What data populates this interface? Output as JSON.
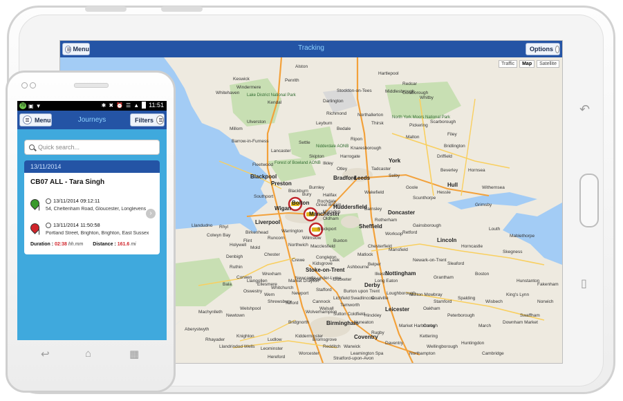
{
  "tablet": {
    "menu_label": "Menu",
    "title": "Tracking",
    "options_label": "Options",
    "map_types": [
      "Traffic",
      "Map",
      "Satellite"
    ],
    "map_type_selected": "Map",
    "map_labels": [
      "Windermere",
      "Kendal",
      "Lake District National Park",
      "Whitehaven",
      "Ulverston",
      "Millom",
      "Barrow-in-Furness",
      "Lancaster",
      "Fleetwood",
      "Blackpool",
      "Forest of Bowland AONB",
      "Preston",
      "Southport",
      "Blackburn",
      "Burnley",
      "Wigan",
      "Bolton",
      "Manchester",
      "Stockport",
      "Liverpool",
      "Birkenhead",
      "Warrington",
      "Runcorn",
      "Chester",
      "Colwyn Bay",
      "Wrexham",
      "Macclesfield",
      "Congleton",
      "Stoke-on-Trent",
      "Newcastle-under-Lyme",
      "Stafford",
      "Telford",
      "Shrewsbury",
      "Nidderdale AONB",
      "Harrogate",
      "Leeds",
      "Bradford",
      "Huddersfield",
      "Halifax",
      "Wakefield",
      "Barnsley",
      "Sheffield",
      "Doncaster",
      "Scunthorpe",
      "Grimsby",
      "York",
      "Selby",
      "Hull",
      "Bridlington",
      "Scarborough",
      "Whitby",
      "Middlesbrough",
      "Stockton-on-Tees",
      "Darlington",
      "North York Moors National Park",
      "Ripon",
      "Thirsk",
      "Malton",
      "Pickering",
      "Lincoln",
      "Worksop",
      "Chesterfield",
      "Mansfield",
      "Nottingham",
      "Derby",
      "Loughborough",
      "Leicester",
      "Newark-on-Trent",
      "Grantham",
      "Boston",
      "Skegness",
      "Louth",
      "Peterborough",
      "King's Lynn",
      "Norwich",
      "Cambridge",
      "Northampton",
      "Coventry",
      "Birmingham",
      "Wolverhampton",
      "Walsall",
      "Tamworth",
      "Nuneaton",
      "Rugby",
      "Leamington Spa",
      "Kidderminster",
      "Bromsgrove",
      "Redditch",
      "Aberystwyth",
      "Wisbech",
      "Spalding",
      "Stamford",
      "Kettering",
      "Corby",
      "Burton upon Trent",
      "Lichfield",
      "Cannock",
      "Sutton Coldfield",
      "Buxton",
      "Matlock",
      "Hornsea",
      "Goole",
      "Penrith",
      "Great Britain",
      "Marsden",
      "Gainsborough",
      "Retford",
      "Whitchurch",
      "Newtown",
      "Welshpool",
      "Bridgnorth",
      "Kidsgrove",
      "Leek",
      "Crewe",
      "Northwich",
      "Wilmslow",
      "Bury",
      "Rochdale",
      "Oldham",
      "Keswick",
      "Alston",
      "Richmond",
      "Leyburn",
      "Settle",
      "Skipton",
      "Ilkley",
      "Otley",
      "Knaresborough",
      "Tadcaster",
      "Rotherham",
      "Hessle",
      "Withernsea",
      "Beverley",
      "Driffield",
      "Filey",
      "Hartlepool",
      "Redcar",
      "Guisborough",
      "Northallerton",
      "Bedale",
      "Mold",
      "Flint",
      "Holywell",
      "Rhyl",
      "Denbigh",
      "Ruthin",
      "Llandudno",
      "Oswestry",
      "Ellesmere",
      "Market Drayton",
      "Stone",
      "Uttoxeter",
      "Ashbourne",
      "Belper",
      "Ilkeston",
      "Long Eaton",
      "Melton Mowbray",
      "Oakham",
      "Sleaford",
      "Horncastle",
      "Mablethorpe",
      "Hunstanton",
      "Fakenham",
      "Swaffham",
      "Downham Market",
      "March",
      "Huntingdon",
      "Wellingborough",
      "Market Harborough",
      "Hinckley",
      "Coalville",
      "Swadlincote",
      "Daventry",
      "Warwick",
      "Stratford-upon-Avon",
      "Worcester",
      "Hereford",
      "Ludlow",
      "Leominster",
      "Knighton",
      "Llandrindod Wells",
      "Rhayader",
      "Machynlleth",
      "Bala",
      "Corwen",
      "Llangollen",
      "Wem",
      "Newport"
    ],
    "vehicle_markers": [
      "marker-1",
      "marker-2",
      "marker-3"
    ]
  },
  "phone": {
    "status_bar": {
      "badge": "70",
      "time": "11:51"
    },
    "menu_label": "Menu",
    "title": "Journeys",
    "filters_label": "Filters",
    "search_placeholder": "Quick search...",
    "date_header": "13/11/2014",
    "journey": {
      "title": "CB07 ALL -  Tara Singh",
      "start_time": "13/11/2014 09:12:11",
      "start_address": "54, Cheltenham Road, Gloucester, Longlevens",
      "end_time": "13/11/2014 11:50:58",
      "end_address": "Portland Street, Brighton, Brighton, East Sussex",
      "duration_label": "Duration :",
      "duration_value": "02:38",
      "duration_unit": "hh.mm",
      "distance_label": "Distance :",
      "distance_value": "161.6",
      "distance_unit": "mi"
    },
    "colors": {
      "header_blue": "#2454a5",
      "screen_blue": "#3fa9dd",
      "start_pin": "#3a9a2c",
      "end_pin": "#d0242a",
      "accent_red": "#d0242a"
    }
  }
}
